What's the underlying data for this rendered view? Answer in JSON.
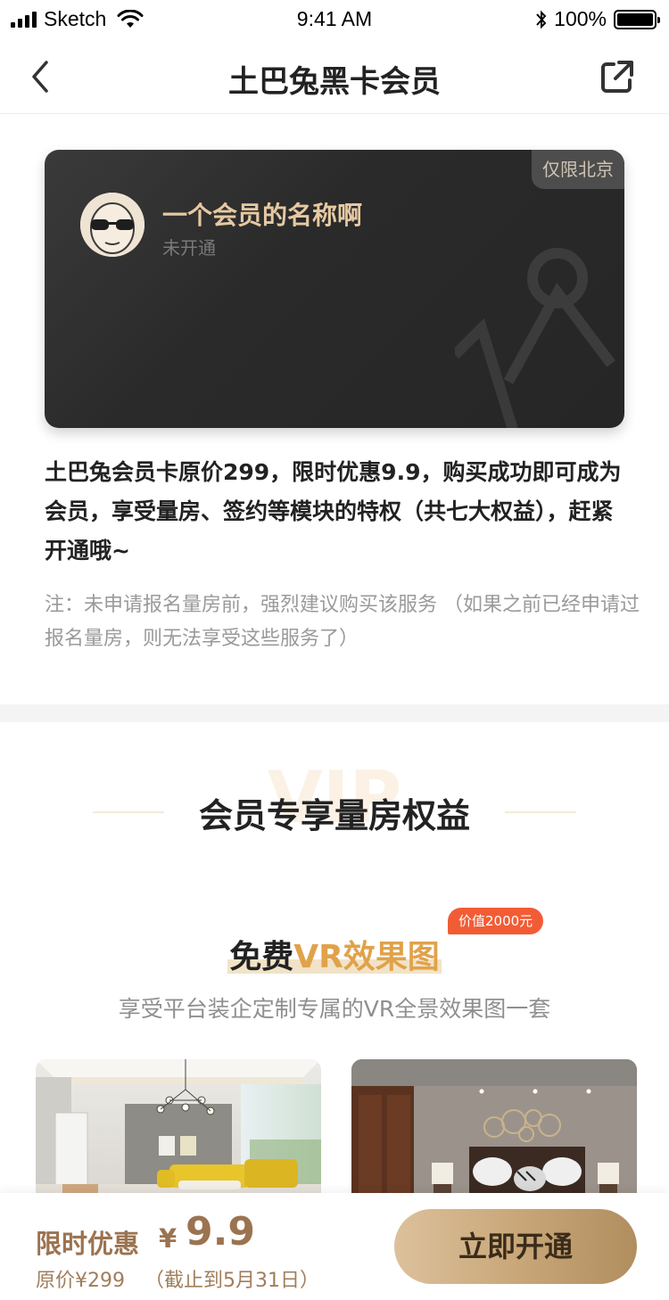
{
  "status_bar": {
    "carrier": "Sketch",
    "time": "9:41 AM",
    "battery_percent": "100%"
  },
  "nav": {
    "title": "土巴兔黑卡会员"
  },
  "card": {
    "region_badge": "仅限北京",
    "member_name": "一个会员的名称啊",
    "member_status": "未开通"
  },
  "description": {
    "main": "土巴兔会员卡原价299，限时优惠9.9，购买成功即可成为会员，享受量房、签约等模块的特权（共七大权益），赶紧开通哦~",
    "note": "注：未申请报名量房前，强烈建议购买该服务 （如果之前已经申请过报名量房，则无法享受这些服务了）"
  },
  "section": {
    "watermark": "VIP",
    "title": "会员专享量房权益"
  },
  "benefit": {
    "value_badge": "价值2000元",
    "title_dark": "免费",
    "title_gold": "VR效果图",
    "subtitle": "享受平台装企定制专属的VR全景效果图一套"
  },
  "bottom": {
    "promo_label": "限时优惠",
    "currency": "¥",
    "price": "9.9",
    "original_price": "原价¥299",
    "deadline": "（截止到5月31日）",
    "cta": "立即开通"
  },
  "colors": {
    "gold": "#e0a24a",
    "brown": "#9b7350",
    "badge_red": "#f25c35",
    "card_dark": "#2a2a2a"
  }
}
